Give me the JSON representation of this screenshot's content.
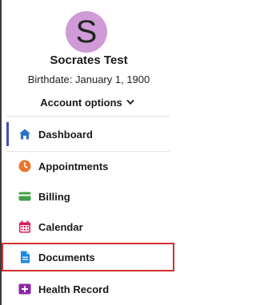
{
  "profile": {
    "avatar_letter": "S",
    "name": "Socrates Test",
    "birthdate": "Birthdate: January 1, 1900",
    "account_options_label": "Account options"
  },
  "nav": {
    "items": [
      {
        "label": "Dashboard",
        "icon": "home-icon",
        "color": "#2a73c8",
        "active": true
      },
      {
        "label": "Appointments",
        "icon": "clock-icon",
        "color": "#e8762c"
      },
      {
        "label": "Billing",
        "icon": "wallet-icon",
        "color": "#43a047"
      },
      {
        "label": "Calendar",
        "icon": "calendar-icon",
        "color": "#d81b60"
      },
      {
        "label": "Documents",
        "icon": "document-icon",
        "color": "#1e88e5",
        "highlighted": true
      },
      {
        "label": "Health Record",
        "icon": "medical-record-icon",
        "color": "#8e24aa"
      }
    ]
  },
  "colors": {
    "avatar_bg": "#cf9ad6",
    "active_indicator": "#3f51b5",
    "highlight_border": "#d32f2f"
  }
}
